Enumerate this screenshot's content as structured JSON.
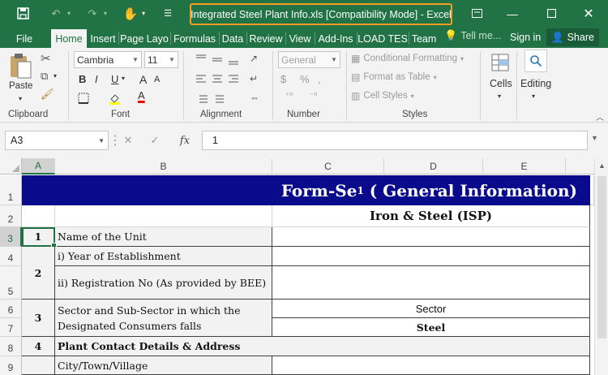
{
  "window": {
    "title": "Integrated Steel Plant Info.xls  [Compatibility Mode] - Excel"
  },
  "tabs": [
    "File",
    "Home",
    "Insert",
    "Page Layo",
    "Formulas",
    "Data",
    "Review",
    "View",
    "Add-Ins",
    "LOAD TES",
    "Team"
  ],
  "active_tab": "Home",
  "tell_me": "Tell me...",
  "sign_in": "Sign in",
  "share": "Share",
  "ribbon": {
    "clipboard": {
      "label": "Clipboard",
      "paste": "Paste"
    },
    "font": {
      "label": "Font",
      "name": "Cambria",
      "size": "11",
      "bold": "B",
      "italic": "I",
      "underline": "U",
      "grow": "A",
      "shrink": "A",
      "font_color": "A"
    },
    "alignment": {
      "label": "Alignment"
    },
    "number": {
      "label": "Number",
      "format": "General",
      "percent": "%"
    },
    "styles": {
      "label": "Styles",
      "conditional": "Conditional Formatting",
      "format_table": "Format as Table",
      "cell_styles": "Cell Styles"
    },
    "cells": {
      "label": "Cells"
    },
    "editing": {
      "label": "Editing"
    }
  },
  "formula_bar": {
    "name_box": "A3",
    "fx": "fx",
    "value": "1"
  },
  "columns": [
    "A",
    "B",
    "C",
    "D",
    "E"
  ],
  "rows": [
    "1",
    "2",
    "3",
    "4",
    "5",
    "6",
    "7",
    "8",
    "9"
  ],
  "sheet": {
    "banner_title": "Form-Se",
    "banner_sub": "1",
    "banner_rest": " ( General Information)",
    "subtitle": "Iron & Steel (ISP)",
    "r3_num": "1",
    "r3_label": "Name of the Unit",
    "r4_num": "2",
    "r4_label": "i) Year of Establishment",
    "r5_label": "ii) Registration No (As provided by BEE)",
    "r6_num": "3",
    "r6_label_line1": "Sector and Sub-Sector in which the",
    "r6_label_line2": "Designated Consumers falls",
    "r6_sector": "Sector",
    "r7_value": "Steel",
    "r8_num": "4",
    "r8_label": "Plant Contact Details & Address",
    "r9_label": "City/Town/Village"
  },
  "colors": {
    "excel_green": "#217346",
    "banner": "#0a0a8c",
    "highlight": "#f59a23"
  }
}
